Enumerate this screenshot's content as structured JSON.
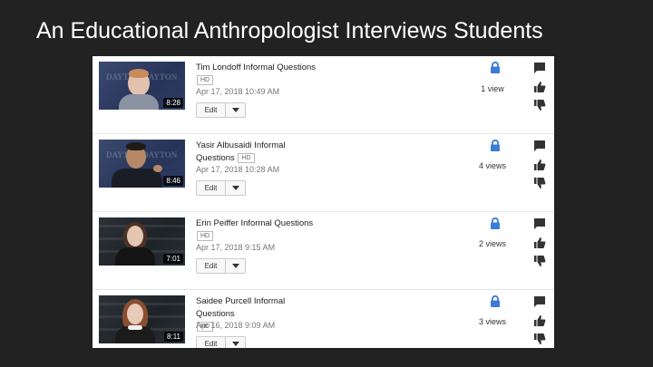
{
  "slide": {
    "title": "An Educational Anthropologist Interviews Students"
  },
  "videos": [
    {
      "title": "Tim Londoff Informal Questions",
      "hd_badge": "HD",
      "date": "Apr 17, 2018 10:49 AM",
      "duration": "8:28",
      "edit_label": "Edit",
      "views": "1 view",
      "thumb_style": "navy"
    },
    {
      "title": "Yasir Albusaidi Informal Questions",
      "hd_badge": "HD",
      "date": "Apr 17, 2018 10:28 AM",
      "duration": "8:46",
      "edit_label": "Edit",
      "views": "4 views",
      "thumb_style": "navy"
    },
    {
      "title": "Erin Peiffer Informal Questions",
      "hd_badge": "HD",
      "date": "Apr 17, 2018 9:15 AM",
      "duration": "7:01",
      "edit_label": "Edit",
      "views": "2 views",
      "thumb_style": "dark"
    },
    {
      "title": "Saidee Purcell Informal Questions",
      "hd_badge": "HD",
      "date": "Apr 16, 2018 9:09 AM",
      "duration": "8:11",
      "edit_label": "Edit",
      "views": "3 views",
      "thumb_style": "dark"
    }
  ],
  "icons": {
    "privacy": "lock-icon",
    "comments": "comment-icon",
    "likes": "thumbs-up-icon",
    "dislikes": "thumbs-down-icon",
    "edit_menu": "caret-down-icon"
  },
  "colors": {
    "background": "#222222",
    "lock_blue": "#3d7cd6",
    "icon_gray": "#333333"
  }
}
